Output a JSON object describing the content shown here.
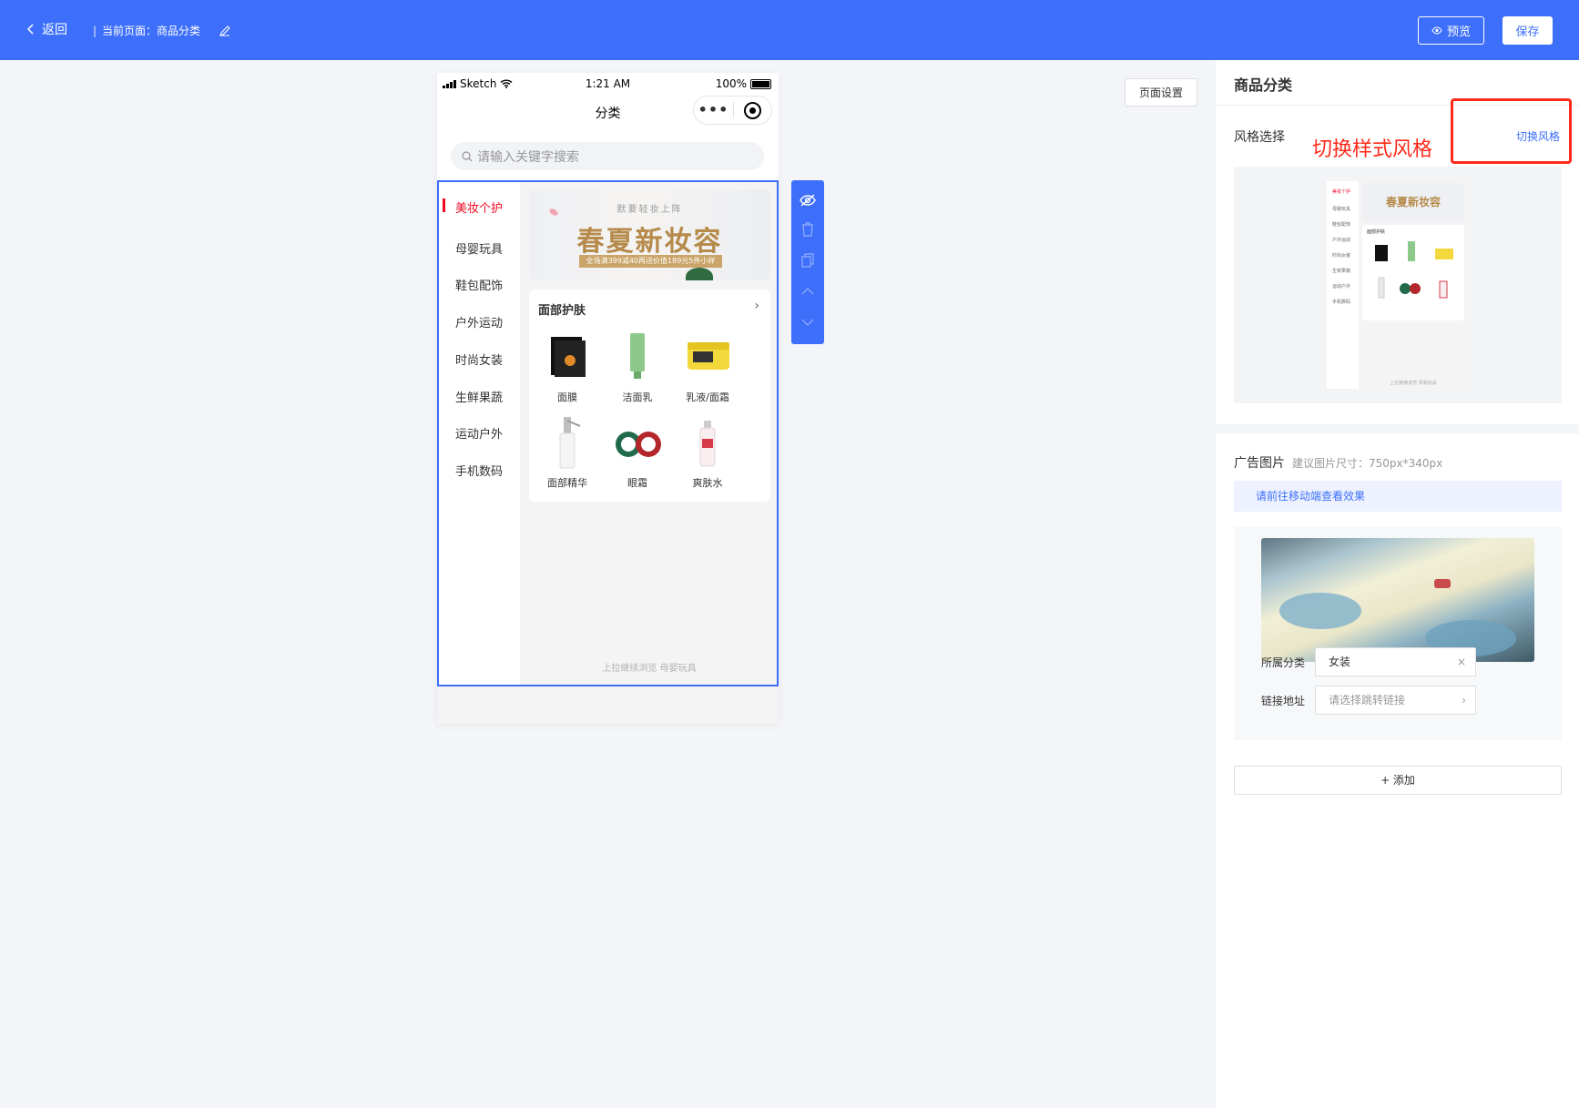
{
  "topbar": {
    "back_label": "返回",
    "current_page_label": "当前页面：商品分类",
    "separator": "|",
    "preview_label": "预览",
    "save_label": "保存",
    "bg_color": "#3d6ffb"
  },
  "phone": {
    "status": {
      "carrier": "Sketch",
      "time": "1:21 AM",
      "battery": "100%"
    },
    "nav_title": "分类",
    "search_placeholder": "请输入关键字搜索",
    "categories": [
      {
        "label": "美妆个护",
        "active": true
      },
      {
        "label": "母婴玩具",
        "active": false
      },
      {
        "label": "鞋包配饰",
        "active": false
      },
      {
        "label": "户外运动",
        "active": false
      },
      {
        "label": "时尚女装",
        "active": false
      },
      {
        "label": "生鲜果蔬",
        "active": false
      },
      {
        "label": "运动户外",
        "active": false
      },
      {
        "label": "手机数码",
        "active": false
      }
    ],
    "banner": {
      "top_text": "默要轻妆上阵",
      "main_text": "春夏新妆容",
      "sub_text": "全场满399减40再送价值189元5件小样"
    },
    "product_section": {
      "title": "面部护肤",
      "products": [
        {
          "name": "面膜",
          "icon": "mask-box-icon"
        },
        {
          "name": "洁面乳",
          "icon": "cleanser-tube-icon"
        },
        {
          "name": "乳液/面霜",
          "icon": "cream-jar-icon"
        },
        {
          "name": "面部精华",
          "icon": "serum-bottle-icon"
        },
        {
          "name": "眼霜",
          "icon": "eye-cream-icon"
        },
        {
          "name": "爽肤水",
          "icon": "toner-bottle-icon"
        }
      ]
    },
    "footer_tip": "上拉继续浏览 母婴玩具"
  },
  "page_settings_label": "页面设置",
  "right_panel": {
    "title": "商品分类",
    "style_label": "风格选择",
    "switch_style_label": "切换风格",
    "annotation": "切换样式风格",
    "preview_thumbnail": {
      "categories": [
        "美妆个护",
        "母婴玩具",
        "鞋包配饰",
        "户外运动",
        "时尚女装",
        "生鲜果蔬",
        "运动户外",
        "手机数码"
      ],
      "banner_text": "春夏新妆容",
      "section_title": "面部护肤",
      "footer_tip": "上拉继续浏览 母婴玩具"
    },
    "ad_label": "广告图片",
    "ad_hint": "建议图片尺寸：750px*340px",
    "notice": "请前往移动端查看效果",
    "ad_item": {
      "category_label": "所属分类",
      "category_value": "女装",
      "link_label": "链接地址",
      "link_placeholder": "请选择跳转链接"
    },
    "add_label": "+ 添加"
  },
  "colors": {
    "accent": "#3d6ffb",
    "active_red": "#ee0a24",
    "annotation_red": "#ff2a1a"
  }
}
